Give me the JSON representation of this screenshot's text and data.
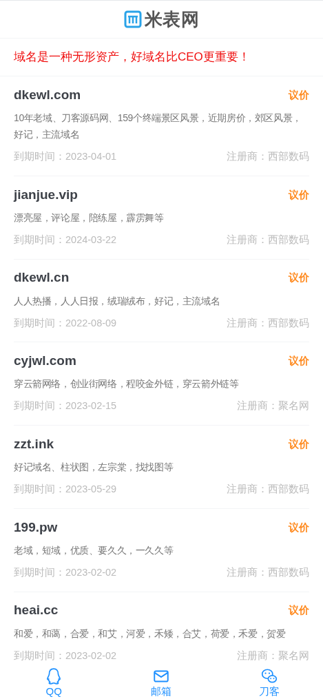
{
  "logo": {
    "text": "米表网"
  },
  "notice": "域名是一种无形资产，好域名比CEO更重要！",
  "domains": [
    {
      "name": "dkewl.com",
      "action": "议价",
      "description": "10年老域、刀客源码网、159个终端景区风景，近期房价，郊区风景，好记，主流域名",
      "expiry": "到期时间：2023-04-01",
      "registrar": "注册商：西部数码"
    },
    {
      "name": "jianjue.vip",
      "action": "议价",
      "description": "漂亮屋，评论屋，陪练屋，霹雳舞等",
      "expiry": "到期时间：2024-03-22",
      "registrar": "注册商：西部数码"
    },
    {
      "name": "dkewl.cn",
      "action": "议价",
      "description": "人人热播，人人日报，绒瑞绒布，好记，主流域名",
      "expiry": "到期时间：2022-08-09",
      "registrar": "注册商：西部数码"
    },
    {
      "name": "cyjwl.com",
      "action": "议价",
      "description": "穿云箭网络，创业街网络，程咬金外链，穿云箭外链等",
      "expiry": "到期时间：2023-02-15",
      "registrar": "注册商：聚名网"
    },
    {
      "name": "zzt.ink",
      "action": "议价",
      "description": "好记域名、柱状图，左宗棠，找找图等",
      "expiry": "到期时间：2023-05-29",
      "registrar": "注册商：西部数码"
    },
    {
      "name": "199.pw",
      "action": "议价",
      "description": "老域，短域，优质、要久久，一久久等",
      "expiry": "到期时间：2023-02-02",
      "registrar": "注册商：西部数码"
    },
    {
      "name": "heai.cc",
      "action": "议价",
      "description": "和爱，和蔼，合爱，和艾，河爱，禾矮，合艾，荷爱，禾爱，贺爱",
      "expiry": "到期时间：2023-02-02",
      "registrar": "注册商：聚名网"
    }
  ],
  "bottom_nav": [
    {
      "kind": "qq",
      "label": "QQ"
    },
    {
      "kind": "mail",
      "label": "邮箱"
    },
    {
      "kind": "wechat",
      "label": "刀客"
    }
  ]
}
